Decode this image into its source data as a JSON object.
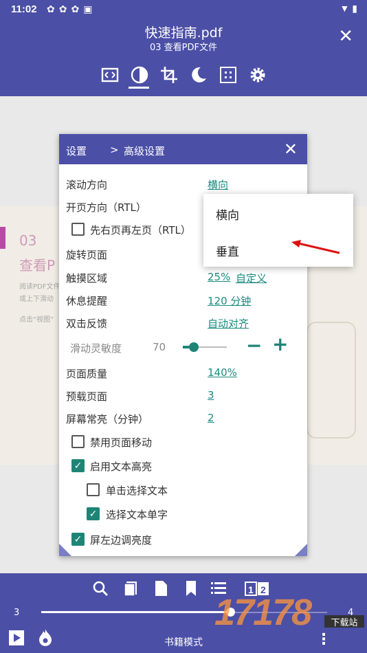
{
  "status": {
    "time": "11:02"
  },
  "header": {
    "title": "快速指南.pdf",
    "subtitle": "03 查看PDF文件"
  },
  "toolbar_icons": [
    "fullscreen-icon",
    "contrast-icon",
    "crop-icon",
    "night-mode-icon",
    "focus-icon",
    "settings-icon"
  ],
  "page_preview": {
    "chapter": "03",
    "heading": "查看P",
    "line1": "阅读PDF文件",
    "line2": "或上下滑动",
    "line3": "点击“视图”"
  },
  "dialog": {
    "breadcrumb_root": "设置",
    "breadcrumb_sep": ">",
    "breadcrumb_current": "高级设置",
    "scroll_direction_label": "滚动方向",
    "scroll_direction_value": "横向",
    "page_direction_label": "开页方向（RTL）",
    "rtl_checkbox_label": "先右页再左页（RTL）",
    "rotate_label": "旋转页面",
    "touch_area_label": "触摸区域",
    "touch_area_value": "25%",
    "touch_area_custom": "自定义",
    "rest_reminder_label": "休息提醒",
    "rest_reminder_value": "120 分钟",
    "double_tap_label": "双击反馈",
    "double_tap_value": "自动对齐",
    "slide_sensitivity_label": "滑动灵敏度",
    "slide_sensitivity_value": "70",
    "slide_sensitivity_fraction": 0.25,
    "page_quality_label": "页面质量",
    "page_quality_value": "140%",
    "preload_label": "预载页面",
    "preload_value": "3",
    "screen_on_label": "屏幕常亮（分钟）",
    "screen_on_value": "2",
    "disable_move_label": "禁用页面移动",
    "enable_highlight_label": "启用文本高亮",
    "single_tap_select_label": "单击选择文本",
    "select_word_label": "选择文本单字",
    "left_brightness_label": "屏左边调亮度",
    "minus": "−",
    "plus": "+"
  },
  "dropdown": {
    "options": [
      "横向",
      "垂直"
    ]
  },
  "bottom": {
    "page_left": "3",
    "page_right": "4",
    "progress_fraction": 0.66,
    "mode_label": "书籍模式"
  },
  "watermark": {
    "text": "17178",
    "sub": "下载站"
  },
  "colors": {
    "primary": "#4b4fa6",
    "accent": "#1e8576"
  }
}
